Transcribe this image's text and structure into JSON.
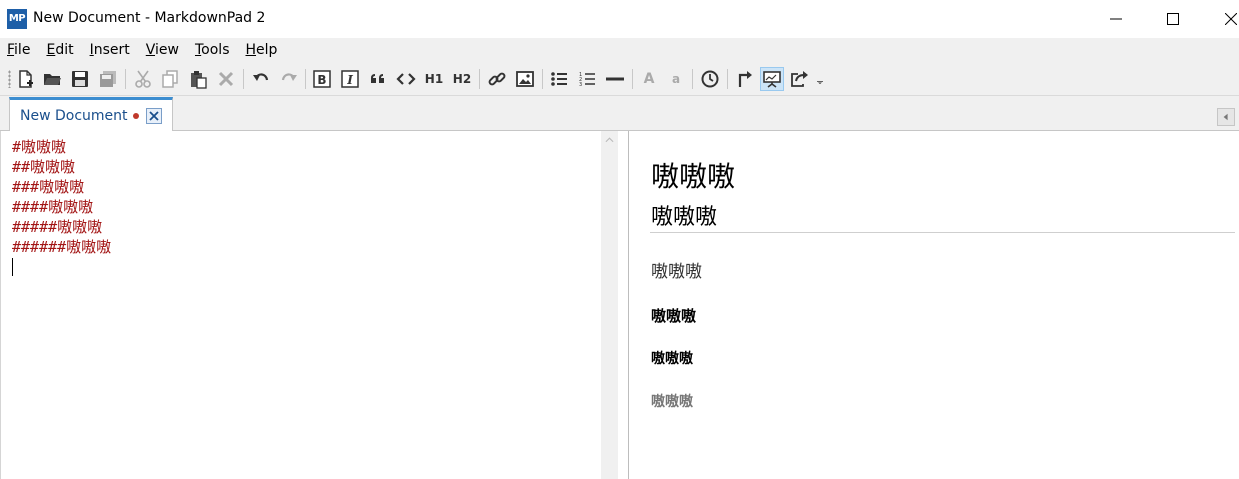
{
  "window": {
    "logo_text": "MP",
    "title": "New Document - MarkdownPad 2"
  },
  "menu": [
    {
      "first": "F",
      "rest": "ile"
    },
    {
      "first": "E",
      "rest": "dit"
    },
    {
      "first": "I",
      "rest": "nsert"
    },
    {
      "first": "V",
      "rest": "iew"
    },
    {
      "first": "T",
      "rest": "ools"
    },
    {
      "first": "H",
      "rest": "elp"
    }
  ],
  "toolbar": {
    "h1_label": "H1",
    "h2_label": "H2",
    "font_increase_label": "A",
    "font_decrease_label": "a",
    "active_tool": "live-preview",
    "icons": [
      "new-document-icon",
      "open-folder-icon",
      "save-icon",
      "save-all-icon",
      "cut-icon",
      "copy-icon",
      "paste-icon",
      "delete-icon",
      "undo-icon",
      "redo-icon",
      "bold-icon",
      "italic-icon",
      "quote-icon",
      "code-icon",
      "link-icon",
      "image-icon",
      "bullet-list-icon",
      "numbered-list-icon",
      "horizontal-rule-icon",
      "timestamp-icon",
      "preview-browser-icon",
      "live-preview-icon",
      "export-icon",
      "overflow-icon"
    ]
  },
  "tabs": [
    {
      "label": "New Document",
      "modified": true
    }
  ],
  "editor": {
    "lines": [
      "#嗷嗷嗷",
      "##嗷嗷嗷",
      "###嗷嗷嗷",
      "####嗷嗷嗷",
      "#####嗷嗷嗷",
      "######嗷嗷嗷"
    ]
  },
  "preview": {
    "h1": "嗷嗷嗷",
    "h2": "嗷嗷嗷",
    "h3": "嗷嗷嗷",
    "h4": "嗷嗷嗷",
    "h5": "嗷嗷嗷",
    "h6": "嗷嗷嗷"
  },
  "colors": {
    "accent": "#3c8dd0",
    "logo": "#1e5fa8",
    "markdown_text": "#a31515",
    "modified_dot": "#c0392b"
  }
}
